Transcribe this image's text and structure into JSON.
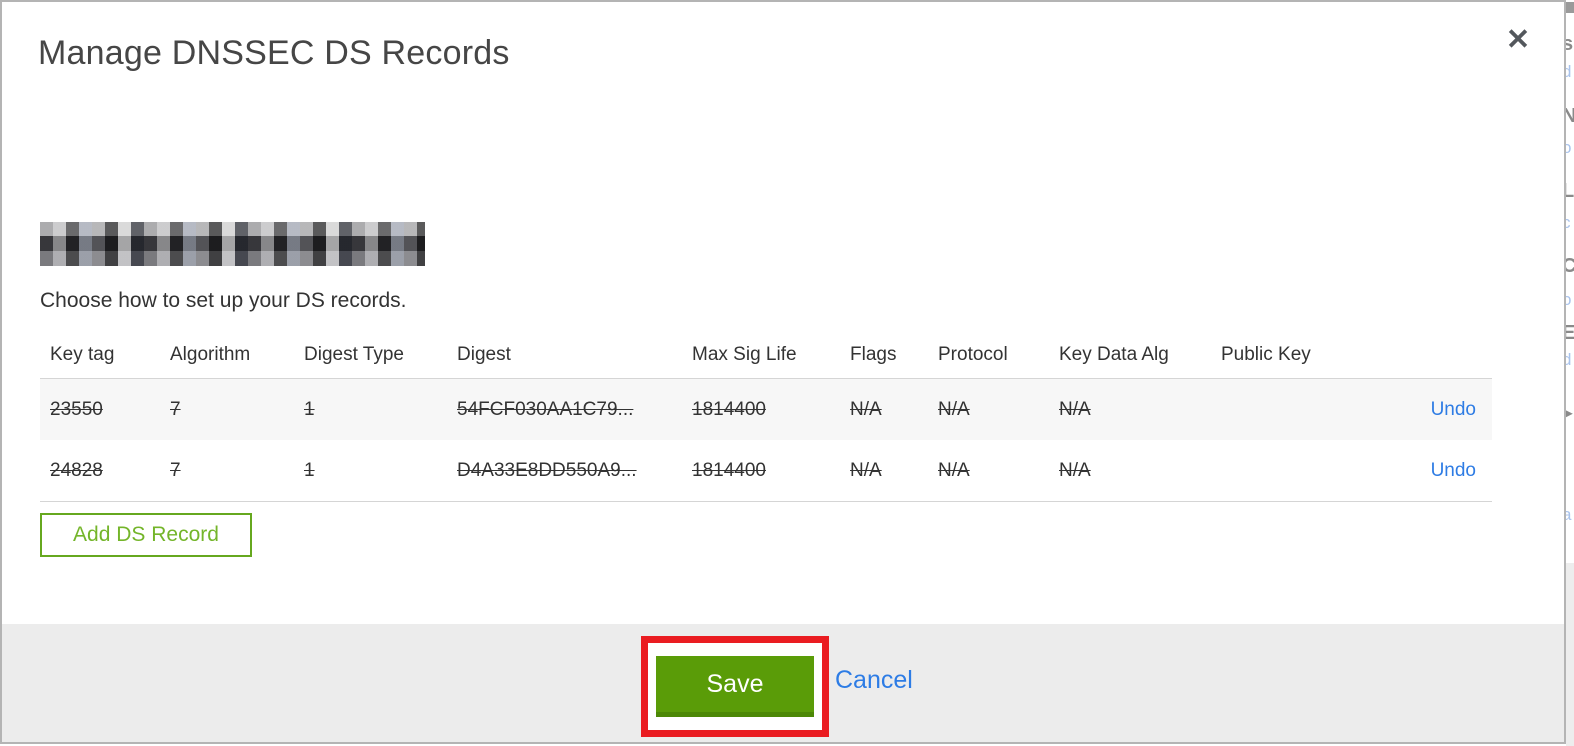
{
  "modal": {
    "title": "Manage DNSSEC DS Records",
    "close_icon": "✕",
    "domain_name_redacted": true,
    "subtitle": "Choose how to set up your DS records.",
    "table": {
      "headers": [
        "Key tag",
        "Algorithm",
        "Digest Type",
        "Digest",
        "Max Sig Life",
        "Flags",
        "Protocol",
        "Key Data Alg",
        "Public Key"
      ],
      "rows": [
        {
          "key_tag": "23550",
          "algorithm": "7",
          "digest_type": "1",
          "digest": "54FCF030AA1C79...",
          "max_sig_life": "1814400",
          "flags": "N/A",
          "protocol": "N/A",
          "key_data_alg": "N/A",
          "public_key": "",
          "action": "Undo",
          "marked_deleted": true
        },
        {
          "key_tag": "24828",
          "algorithm": "7",
          "digest_type": "1",
          "digest": "D4A33E8DD550A9...",
          "max_sig_life": "1814400",
          "flags": "N/A",
          "protocol": "N/A",
          "key_data_alg": "N/A",
          "public_key": "",
          "action": "Undo",
          "marked_deleted": true
        }
      ]
    },
    "add_button_label": "Add DS Record",
    "footer": {
      "save_label": "Save",
      "cancel_label": "Cancel"
    }
  },
  "annotation": {
    "highlight_color": "#ea1c21"
  },
  "colors": {
    "save_green": "#5a9c08",
    "save_green_dark": "#4c8806",
    "add_button_green": "#66a81f",
    "link_blue": "#2e7ce4",
    "footer_gray": "#ececec",
    "row_stripe": "#f7f7f7",
    "modal_border": "#b4b4b4",
    "text_dark": "#333333"
  },
  "background_page_sliver": {
    "chars": [
      {
        "char": "s"
      },
      {
        "char": "d"
      },
      {
        "char": "N"
      },
      {
        "char": "o"
      },
      {
        "char": "L"
      },
      {
        "char": "c"
      },
      {
        "char": "C"
      },
      {
        "char": "o"
      },
      {
        "char": "E"
      },
      {
        "char": "d"
      },
      {
        "char": "▸"
      },
      {
        "char": "a"
      }
    ]
  }
}
